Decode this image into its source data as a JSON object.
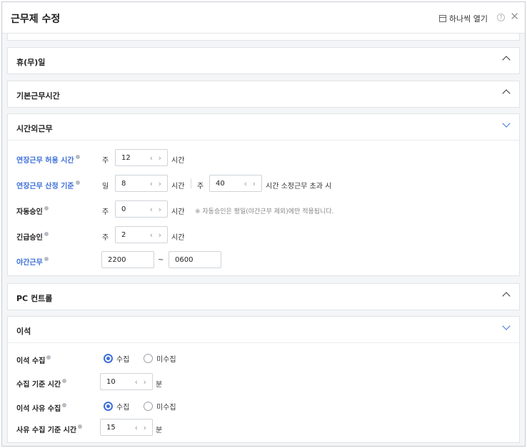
{
  "header": {
    "title": "근무제 수정",
    "open_one_label": "하나씩 열기",
    "help_glyph": "?",
    "close_glyph": "✕"
  },
  "sections": {
    "holiday": {
      "title": "휴(무)일",
      "expanded": false
    },
    "base_hours": {
      "title": "기본근무시간",
      "expanded": false
    },
    "overtime": {
      "title": "시간외근무",
      "expanded": true,
      "ext_allow": {
        "label": "연장근무 허용 시간",
        "prefix": "주",
        "value": "12",
        "unit": "시간"
      },
      "ext_calc": {
        "label": "연장근무 산정 기준",
        "prefix": "일",
        "value": "8",
        "unit": "시간",
        "prefix2": "주",
        "value2": "40",
        "unit2": "시간 소정근무 초과 시"
      },
      "auto_approve": {
        "label": "자동승인",
        "prefix": "주",
        "value": "0",
        "unit": "시간",
        "note": "※ 자동승인은 평일(야간근무 제외)에만 적용됩니다."
      },
      "emergency": {
        "label": "긴급승인",
        "prefix": "주",
        "value": "2",
        "unit": "시간"
      },
      "night": {
        "label": "야간근무",
        "start": "2200",
        "tilde": "~",
        "end": "0600"
      }
    },
    "pc_control": {
      "title": "PC 컨트롤",
      "expanded": false
    },
    "away": {
      "title": "이석",
      "expanded": true,
      "collect": {
        "label": "이석 수집",
        "opt_on": "수집",
        "opt_off": "미수집",
        "selected": "수집"
      },
      "collect_time": {
        "label": "수집 기준 시간",
        "value": "10",
        "unit": "분"
      },
      "reason_collect": {
        "label": "이석 사유 수집",
        "opt_on": "수집",
        "opt_off": "미수집",
        "selected": "수집"
      },
      "reason_time": {
        "label": "사유 수집 기준 시간",
        "value": "15",
        "unit": "분"
      }
    }
  },
  "icons": {
    "stepper_prev": "‹",
    "stepper_next": "›"
  },
  "colors": {
    "accent": "#3d6fd9",
    "border": "#e1e3e6",
    "background": "#f4f5f7"
  }
}
